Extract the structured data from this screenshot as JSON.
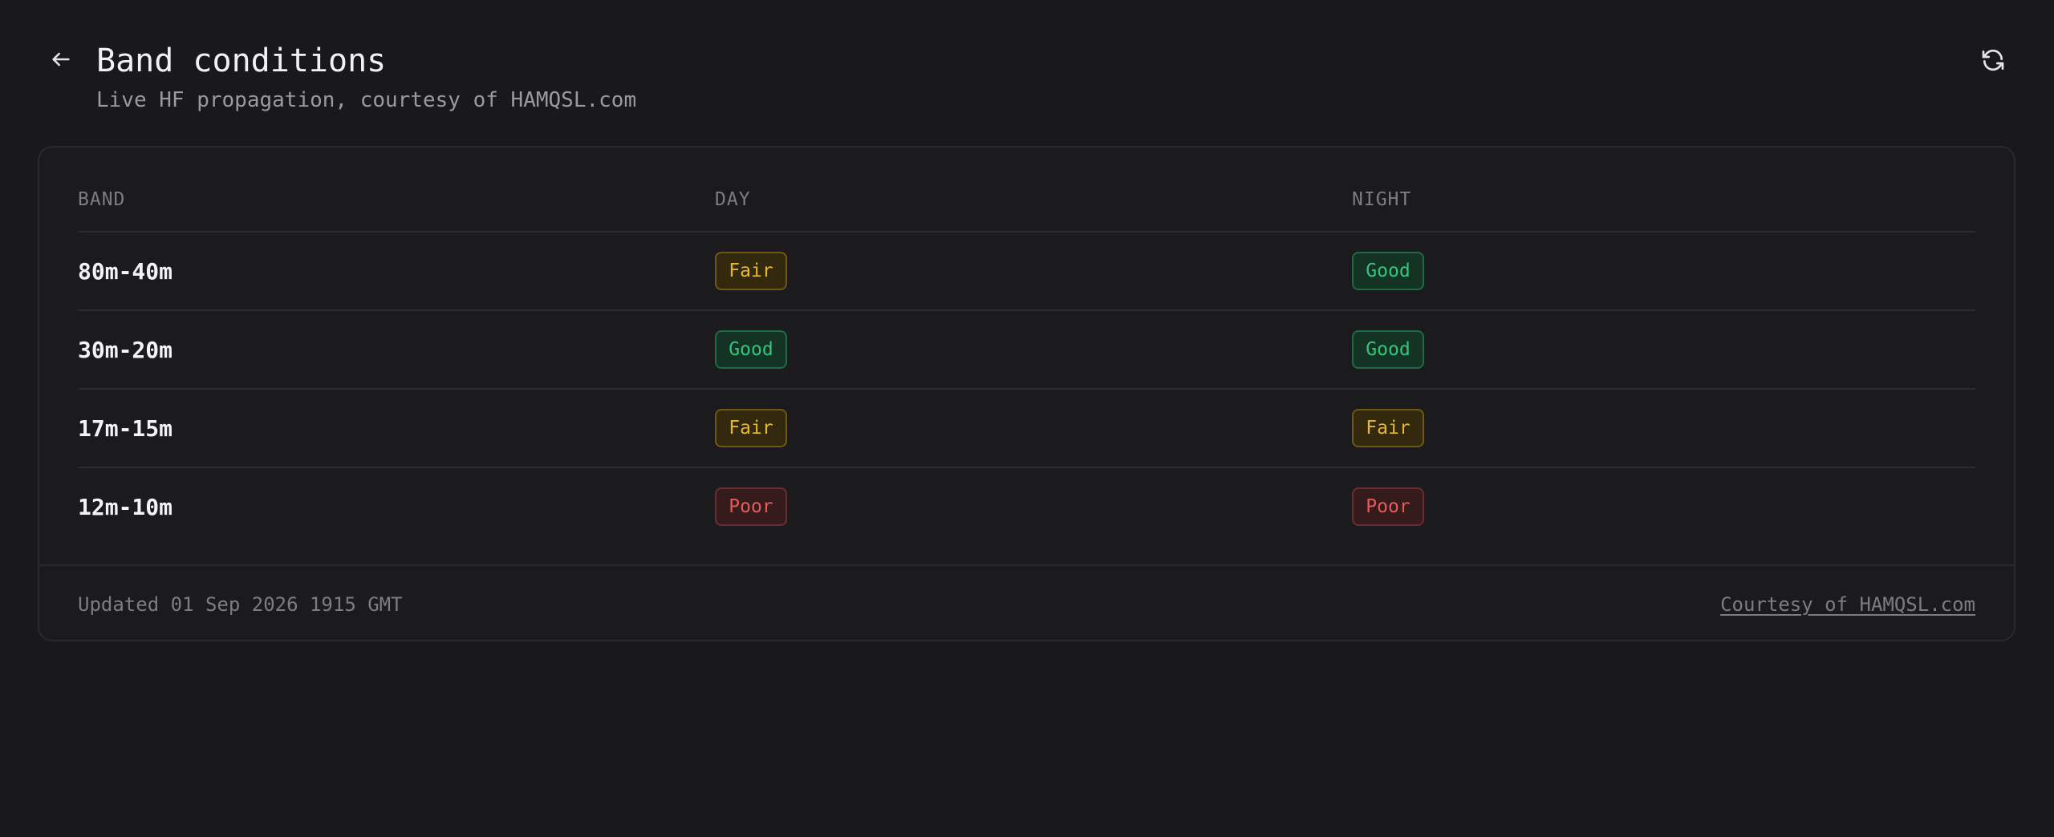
{
  "header": {
    "title": "Band conditions",
    "subtitle": "Live HF propagation, courtesy of HAMQSL.com",
    "back_icon": "arrow-left-icon",
    "refresh_icon": "refresh-icon"
  },
  "table": {
    "columns": [
      "BAND",
      "DAY",
      "NIGHT"
    ],
    "rows": [
      {
        "band": "80m-40m",
        "day": "Fair",
        "night": "Good"
      },
      {
        "band": "30m-20m",
        "day": "Good",
        "night": "Good"
      },
      {
        "band": "17m-15m",
        "day": "Fair",
        "night": "Fair"
      },
      {
        "band": "12m-10m",
        "day": "Poor",
        "night": "Poor"
      }
    ]
  },
  "footer": {
    "updated": "Updated 01 Sep 2026 1915 GMT",
    "courtesy_link": "Courtesy of HAMQSL.com"
  },
  "colors": {
    "background": "#19191b",
    "good": "#34c77b",
    "fair": "#e8b82b",
    "poor": "#e45b5b"
  }
}
